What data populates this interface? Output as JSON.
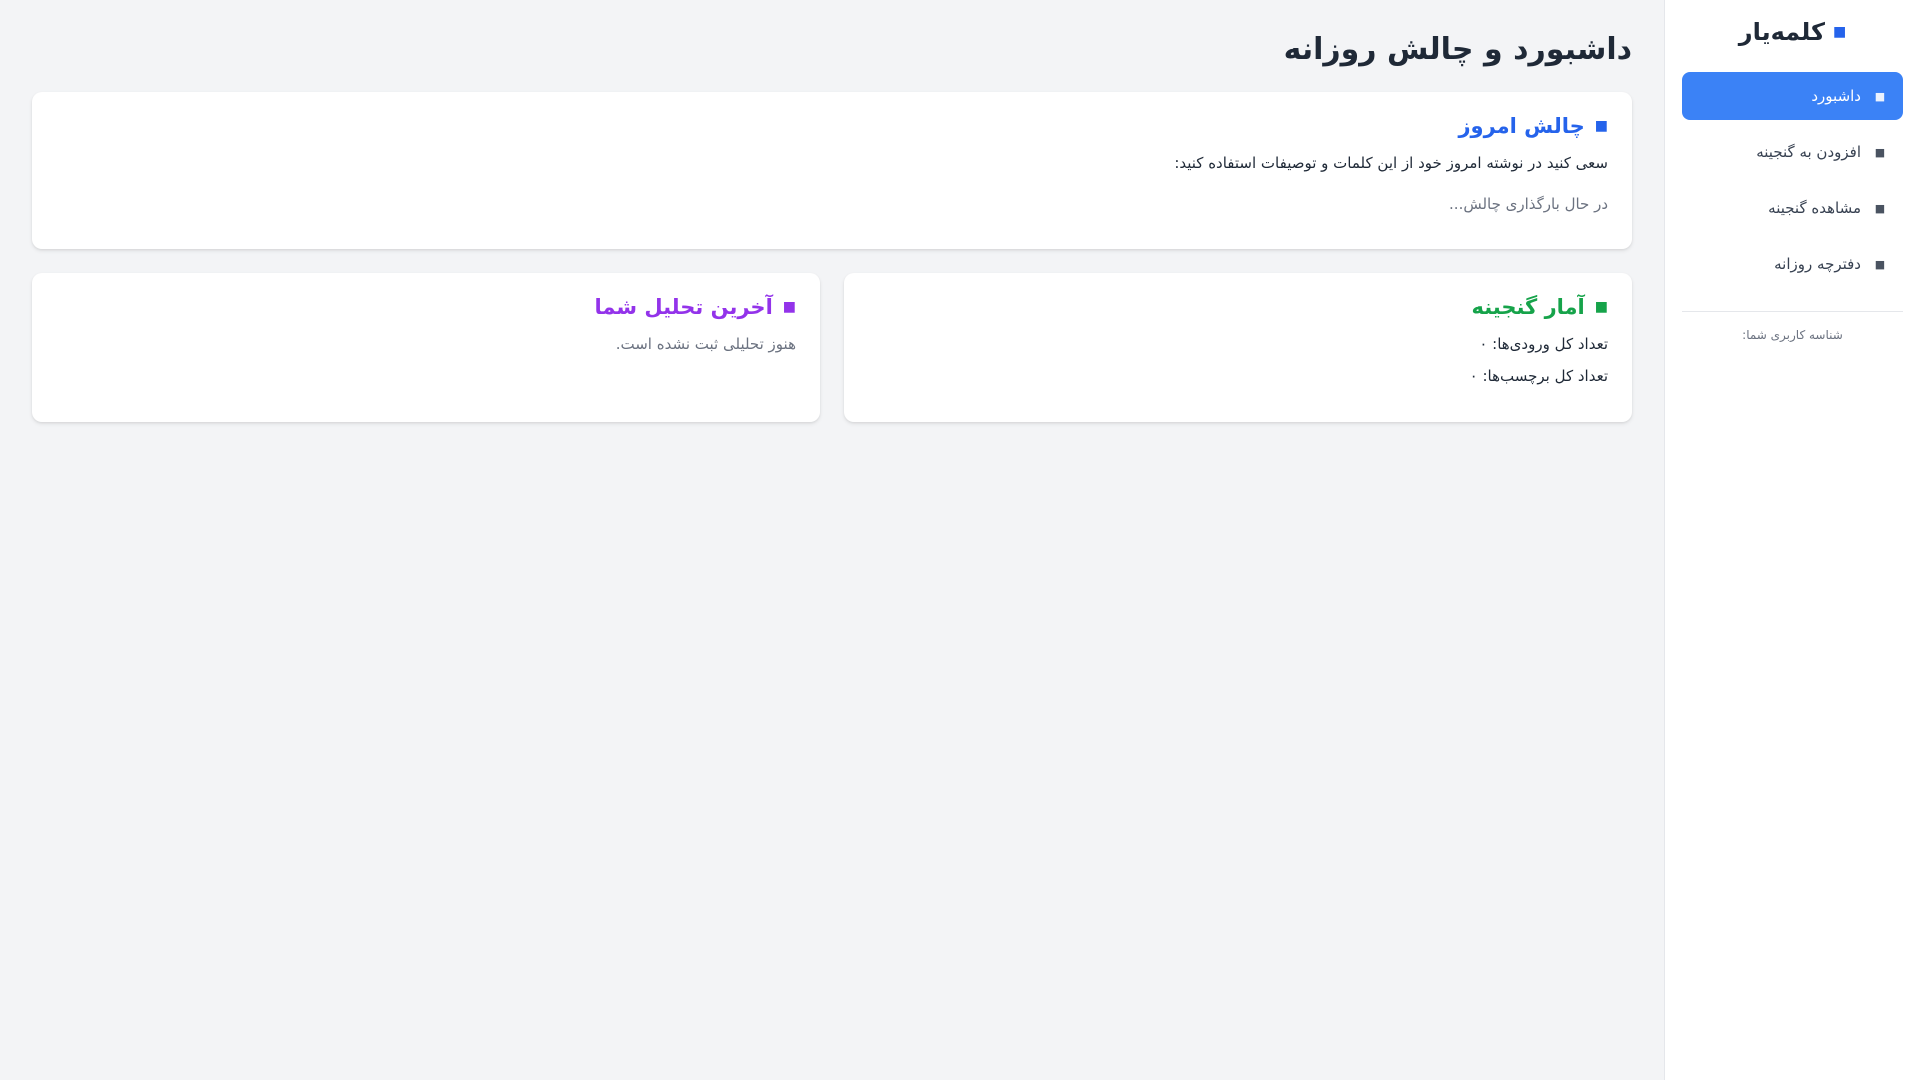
{
  "sidebar": {
    "brand": "کلمه‌یار",
    "brand_icon": "book-icon",
    "items": [
      {
        "label": "داشبورد",
        "icon": "home-icon",
        "active": true
      },
      {
        "label": "افزودن به گنجینه",
        "icon": "plus-icon",
        "active": false
      },
      {
        "label": "مشاهده گنجینه",
        "icon": "list-icon",
        "active": false
      },
      {
        "label": "دفترچه روزانه",
        "icon": "notebook-icon",
        "active": false
      }
    ],
    "user_id_label": "شناسه کاربری شما:"
  },
  "main": {
    "title": "داشبورد و چالش روزانه",
    "challenge": {
      "title": "چالش امروز",
      "intro": "سعی کنید در نوشته امروز خود از این کلمات و توصیفات استفاده کنید:",
      "loading": "در حال بارگذاری چالش..."
    },
    "stats": {
      "title": "آمار گنجینه",
      "total_entries": "تعداد کل ورودی‌ها: ۰",
      "total_tags": "تعداد کل برچسب‌ها: ۰"
    },
    "analysis": {
      "title": "آخرین تحلیل شما",
      "empty": "هنوز تحلیلی ثبت نشده است."
    }
  },
  "colors": {
    "accent": "#3b82f6",
    "challenge_title": "#2563eb",
    "stats_title": "#16a34a",
    "analysis_title": "#9333ea"
  }
}
